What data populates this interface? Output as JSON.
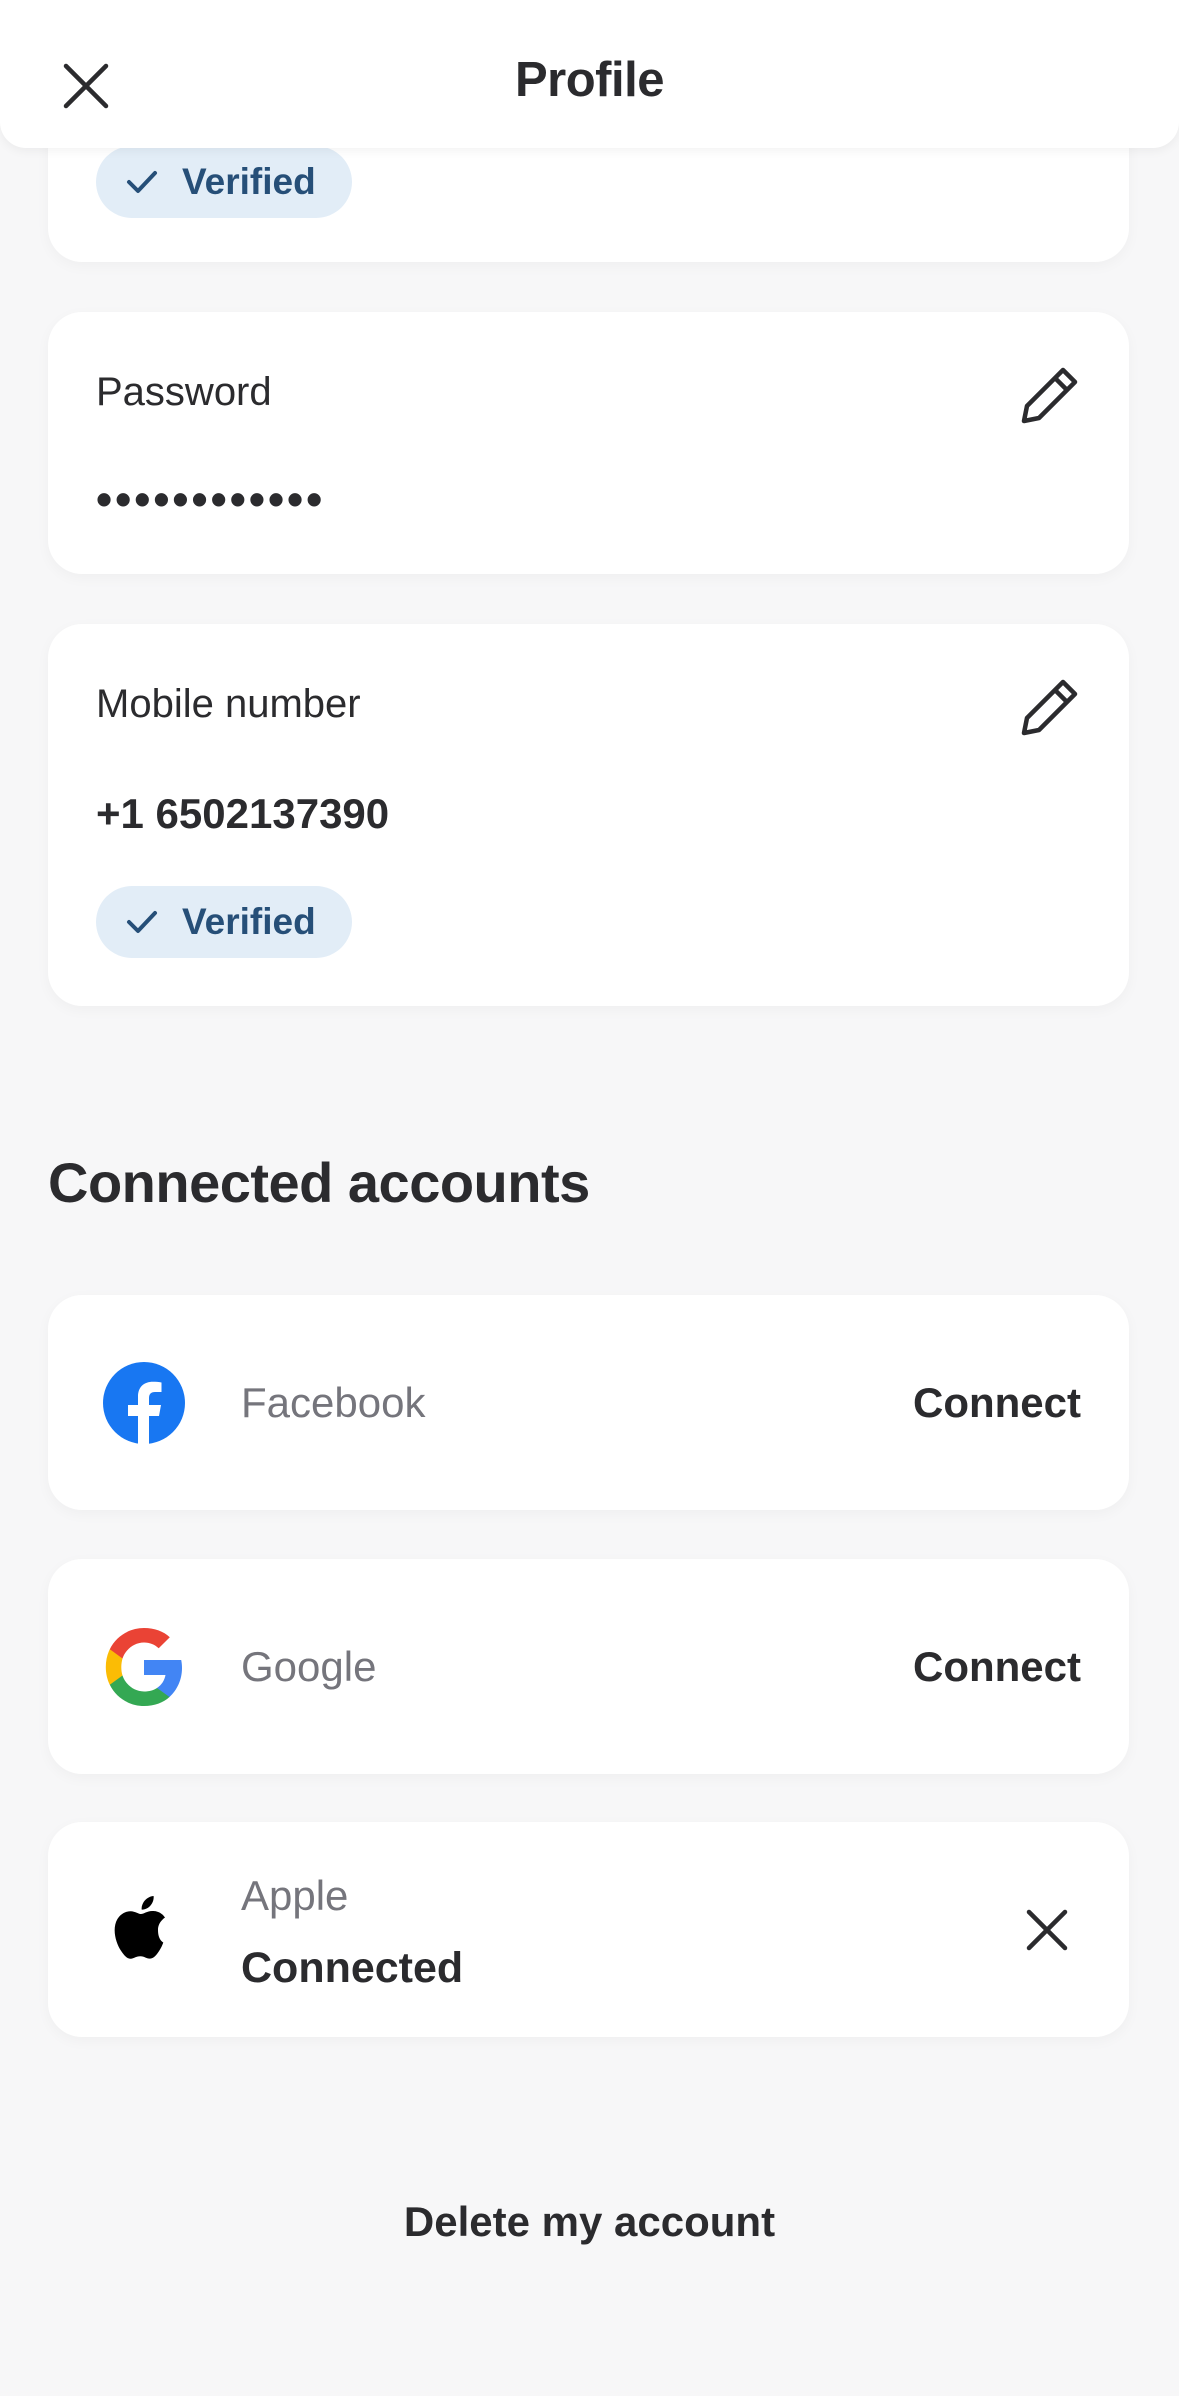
{
  "header": {
    "title": "Profile"
  },
  "email_card": {
    "badge": "Verified"
  },
  "password_card": {
    "label": "Password",
    "value": "••••••••••••"
  },
  "mobile_card": {
    "label": "Mobile number",
    "value": "+1 6502137390",
    "badge": "Verified"
  },
  "connected_accounts": {
    "title": "Connected accounts",
    "facebook": {
      "name": "Facebook",
      "action": "Connect",
      "icon": "facebook-icon",
      "color": "#1877f2"
    },
    "google": {
      "name": "Google",
      "action": "Connect",
      "icon": "google-icon"
    },
    "apple": {
      "name": "Apple",
      "status": "Connected",
      "icon": "apple-icon"
    }
  },
  "footer": {
    "delete_label": "Delete my account"
  },
  "colors": {
    "background": "#f7f7f8",
    "badge_bg": "#e2edf7",
    "badge_text": "#264f78",
    "text_primary": "#2b2b2e",
    "text_secondary": "#75757c"
  }
}
